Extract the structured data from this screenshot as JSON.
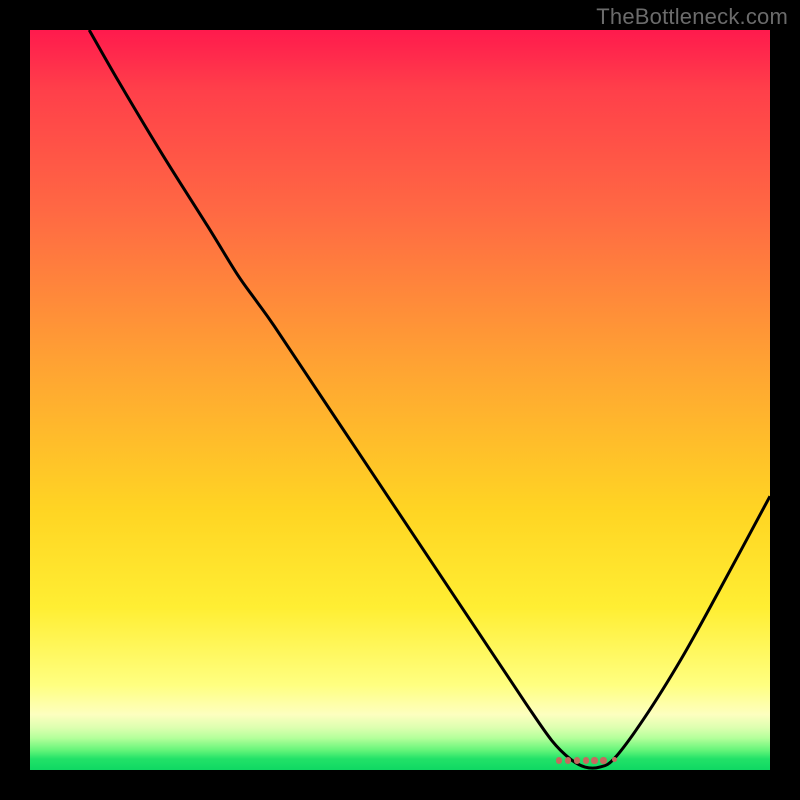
{
  "watermark": "TheBottleneck.com",
  "colors": {
    "curve_stroke": "#000000",
    "marker_fill": "#c46a5e"
  },
  "chart_data": {
    "type": "line",
    "title": "",
    "xlabel": "",
    "ylabel": "",
    "xlim": [
      0,
      100
    ],
    "ylim": [
      0,
      100
    ],
    "series": [
      {
        "name": "curve",
        "x": [
          8,
          12,
          18,
          24,
          28,
          30.5,
          33,
          38,
          44,
          50,
          56,
          62,
          67,
          70.5,
          73,
          75,
          77,
          79,
          83,
          88,
          93,
          100
        ],
        "y": [
          100,
          93,
          83,
          73.5,
          67,
          63.5,
          60,
          52.5,
          43.5,
          34.5,
          25.5,
          16.5,
          9,
          4,
          1.5,
          0.4,
          0.4,
          1.6,
          7,
          15,
          24,
          37
        ]
      }
    ],
    "markers": {
      "name": "highlight-dots",
      "x": [
        71.5,
        72.7,
        73.9,
        75.1,
        76.3,
        77.5,
        79.0
      ],
      "y": [
        1.3,
        1.3,
        1.3,
        1.3,
        1.3,
        1.3,
        1.4
      ],
      "r": [
        3.2,
        3.2,
        3.2,
        3.2,
        3.2,
        3.2,
        2.5
      ]
    }
  }
}
